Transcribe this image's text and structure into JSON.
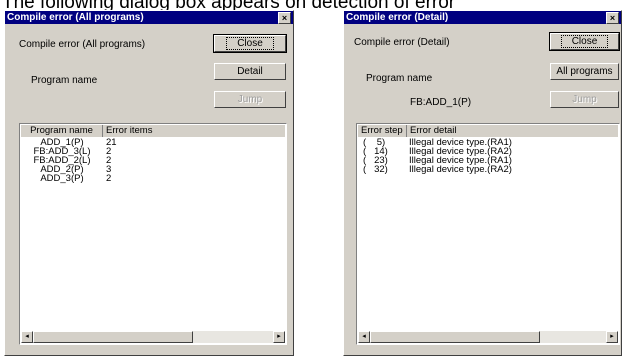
{
  "caption": "The following dialog box appears on detection of error",
  "dialog_all": {
    "title": "Compile error (All programs)",
    "close_x": "×",
    "message": "Compile error (All programs)",
    "program_name_label": "Program name",
    "program_name_value": "",
    "buttons": {
      "close": "Close",
      "detail": "Detail",
      "jump": "Jump"
    },
    "columns": [
      "Program name",
      "Error items"
    ],
    "rows": [
      {
        "name": "ADD_1(P)",
        "count": "21"
      },
      {
        "name": "FB:ADD_3(L)",
        "count": "2"
      },
      {
        "name": "FB:ADD_2(L)",
        "count": "2"
      },
      {
        "name": "ADD_2(P)",
        "count": "3"
      },
      {
        "name": "ADD_3(P)",
        "count": "2"
      }
    ],
    "scroll_left": "◂",
    "scroll_right": "▸"
  },
  "dialog_detail": {
    "title": "Compile error (Detail)",
    "close_x": "×",
    "message": "Compile error (Detail)",
    "program_name_label": "Program name",
    "program_name_value": "FB:ADD_1(P)",
    "buttons": {
      "close": "Close",
      "all_programs": "All programs",
      "jump": "Jump"
    },
    "columns": [
      "Error step",
      "Error detail"
    ],
    "rows": [
      {
        "step": "(    5)",
        "detail": "Illegal device type.(RA1)"
      },
      {
        "step": "(   14)",
        "detail": "Illegal device type.(RA2)"
      },
      {
        "step": "(   23)",
        "detail": "Illegal device type.(RA1)"
      },
      {
        "step": "(   32)",
        "detail": "Illegal device type.(RA2)"
      }
    ],
    "scroll_left": "◂",
    "scroll_right": "▸"
  }
}
